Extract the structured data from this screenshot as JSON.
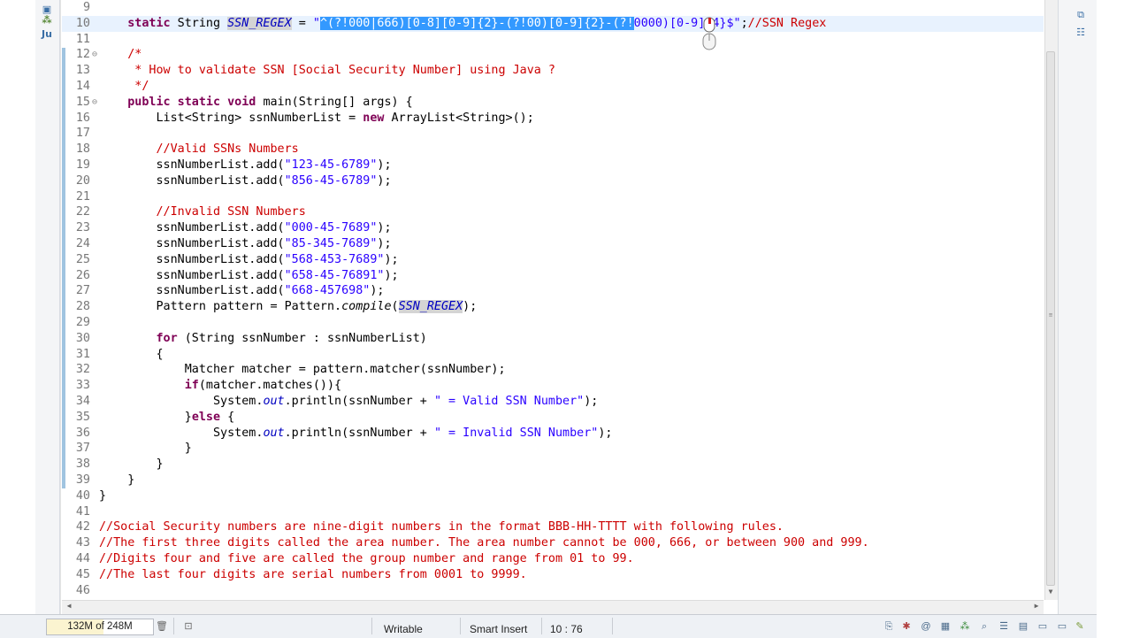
{
  "left_toolbar": {
    "icons": [
      "package-icon",
      "hierarchy-icon",
      "junit-icon"
    ],
    "junit_label": "Ju"
  },
  "editor": {
    "lines": [
      {
        "n": "9",
        "t": ""
      },
      {
        "n": "10",
        "pre": "    static String ",
        "f1": "SSN_REGEX",
        "mid": " = ",
        "q1": "\"",
        "sel": "^(?!000|666)[0-8][0-9]{2}-(?!00)[0-9]{2}-(?!",
        "rest": "0000)[0-9]{4}$\"",
        "tail": ";",
        "cmt": "//SSN Regex"
      },
      {
        "n": "11",
        "t": ""
      },
      {
        "n": "12",
        "t": "    /*",
        "c": "cmt",
        "fold": "⊖"
      },
      {
        "n": "13",
        "t": "     * How to validate SSN [Social Security Number] using Java ?",
        "c": "cmt"
      },
      {
        "n": "14",
        "t": "     */",
        "c": "cmt"
      },
      {
        "n": "15",
        "kw1": "    public static void ",
        "t": "main(String[] args) {",
        "fold": "⊖"
      },
      {
        "n": "16",
        "t": "        List<String> ssnNumberList = ",
        "kw2": "new",
        "t2": " ArrayList<String>();"
      },
      {
        "n": "17",
        "t": ""
      },
      {
        "n": "18",
        "t": "        //Valid SSNs Numbers",
        "c": "cmt"
      },
      {
        "n": "19",
        "pre": "        ssnNumberList.add(",
        "s": "\"123-45-6789\"",
        "post": ");"
      },
      {
        "n": "20",
        "pre": "        ssnNumberList.add(",
        "s": "\"856-45-6789\"",
        "post": ");"
      },
      {
        "n": "21",
        "t": ""
      },
      {
        "n": "22",
        "t": "        //Invalid SSN Numbers",
        "c": "cmt"
      },
      {
        "n": "23",
        "pre": "        ssnNumberList.add(",
        "s": "\"000-45-7689\"",
        "post": ");"
      },
      {
        "n": "24",
        "pre": "        ssnNumberList.add(",
        "s": "\"85-345-7689\"",
        "post": ");"
      },
      {
        "n": "25",
        "pre": "        ssnNumberList.add(",
        "s": "\"568-453-7689\"",
        "post": ");"
      },
      {
        "n": "26",
        "pre": "        ssnNumberList.add(",
        "s": "\"658-45-76891\"",
        "post": ");"
      },
      {
        "n": "27",
        "pre": "        ssnNumberList.add(",
        "s": "\"668-457698\"",
        "post": ");"
      },
      {
        "n": "28",
        "pre": "        Pattern pattern = Pattern.",
        "it": "compile",
        "mid": "(",
        "f1": "SSN_REGEX",
        "post": ");"
      },
      {
        "n": "29",
        "t": ""
      },
      {
        "n": "30",
        "kw1": "        for",
        "t": " (String ssnNumber : ssnNumberList)"
      },
      {
        "n": "31",
        "t": "        {"
      },
      {
        "n": "32",
        "t": "            Matcher matcher = pattern.matcher(ssnNumber);"
      },
      {
        "n": "33",
        "kw1": "            if",
        "t": "(matcher.matches()){"
      },
      {
        "n": "34",
        "pre": "                System.",
        "it": "out",
        "mid": ".println(ssnNumber + ",
        "s": "\" = Valid SSN Number\"",
        "post": ");"
      },
      {
        "n": "35",
        "pre": "            }",
        "kw2": "else",
        "t2": " {"
      },
      {
        "n": "36",
        "pre": "                System.",
        "it": "out",
        "mid": ".println(ssnNumber + ",
        "s": "\" = Invalid SSN Number\"",
        "post": ");"
      },
      {
        "n": "37",
        "t": "            }"
      },
      {
        "n": "38",
        "t": "        }"
      },
      {
        "n": "39",
        "t": "    }"
      },
      {
        "n": "40",
        "t": "}"
      },
      {
        "n": "41",
        "t": ""
      },
      {
        "n": "42",
        "t": "//Social Security numbers are nine-digit numbers in the format BBB-HH-TTTT with following rules.",
        "c": "cmt"
      },
      {
        "n": "43",
        "t": "//The first three digits called the area number. The area number cannot be 000, 666, or between 900 and 999.",
        "c": "cmt"
      },
      {
        "n": "44",
        "t": "//Digits four and five are called the group number and range from 01 to 99.",
        "c": "cmt"
      },
      {
        "n": "45",
        "t": "//The last four digits are serial numbers from 0001 to 9999.",
        "c": "cmt"
      },
      {
        "n": "46",
        "t": ""
      }
    ]
  },
  "status_bar": {
    "heap": "132M of 248M",
    "heap_fraction": 0.53,
    "mode": "Writable",
    "insert_mode": "Smart Insert",
    "position": "10 : 76"
  },
  "right_toolbar": {
    "icons": [
      "restore-icon",
      "outline-icon"
    ]
  }
}
